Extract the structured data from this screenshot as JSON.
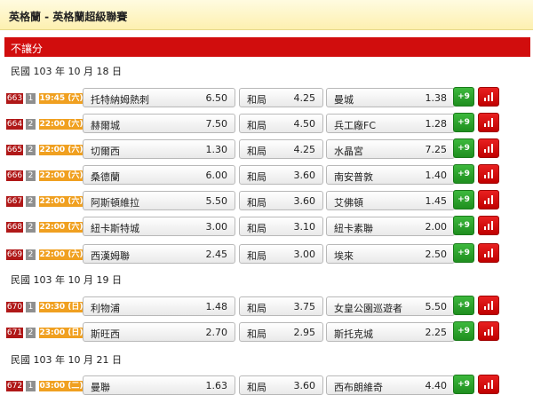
{
  "header": {
    "title": "英格蘭 - 英格蘭超級聯賽"
  },
  "section": {
    "label": "不讓分"
  },
  "colors": {
    "accent": "#d10d0d",
    "plus": "#2aa22a",
    "time": "#f0a020"
  },
  "groups": [
    {
      "date": "民國 103 年 10 月 18 日",
      "matches": [
        {
          "id": "663",
          "num": "1",
          "time": "19:45 (六)",
          "home": "托特納姆熱刺",
          "home_odds": "6.50",
          "draw": "和局",
          "draw_odds": "4.25",
          "away": "曼城",
          "away_odds": "1.38",
          "plus": "+9"
        },
        {
          "id": "664",
          "num": "2",
          "time": "22:00 (六)",
          "home": "赫爾城",
          "home_odds": "7.50",
          "draw": "和局",
          "draw_odds": "4.50",
          "away": "兵工廠FC",
          "away_odds": "1.28",
          "plus": "+9"
        },
        {
          "id": "665",
          "num": "2",
          "time": "22:00 (六)",
          "home": "切爾西",
          "home_odds": "1.30",
          "draw": "和局",
          "draw_odds": "4.25",
          "away": "水晶宮",
          "away_odds": "7.25",
          "plus": "+9"
        },
        {
          "id": "666",
          "num": "2",
          "time": "22:00 (六)",
          "home": "桑德蘭",
          "home_odds": "6.00",
          "draw": "和局",
          "draw_odds": "3.60",
          "away": "南安普敦",
          "away_odds": "1.40",
          "plus": "+9"
        },
        {
          "id": "667",
          "num": "2",
          "time": "22:00 (六)",
          "home": "阿斯頓維拉",
          "home_odds": "5.50",
          "draw": "和局",
          "draw_odds": "3.60",
          "away": "艾佛頓",
          "away_odds": "1.45",
          "plus": "+9"
        },
        {
          "id": "668",
          "num": "2",
          "time": "22:00 (六)",
          "home": "紐卡斯特城",
          "home_odds": "3.00",
          "draw": "和局",
          "draw_odds": "3.10",
          "away": "紐卡素聯",
          "away_odds": "2.00",
          "plus": "+9"
        },
        {
          "id": "669",
          "num": "2",
          "time": "22:00 (六)",
          "home": "西漢姆聯",
          "home_odds": "2.45",
          "draw": "和局",
          "draw_odds": "3.00",
          "away": "埃來",
          "away_odds": "2.50",
          "plus": "+9"
        }
      ]
    },
    {
      "date": "民國 103 年 10 月 19 日",
      "matches": [
        {
          "id": "670",
          "num": "1",
          "time": "20:30 (日)",
          "home": "利物浦",
          "home_odds": "1.48",
          "draw": "和局",
          "draw_odds": "3.75",
          "away": "女皇公園巡遊者",
          "away_odds": "5.50",
          "plus": "+9"
        },
        {
          "id": "671",
          "num": "2",
          "time": "23:00 (日)",
          "home": "斯旺西",
          "home_odds": "2.70",
          "draw": "和局",
          "draw_odds": "2.95",
          "away": "斯托克城",
          "away_odds": "2.25",
          "plus": "+9"
        }
      ]
    },
    {
      "date": "民國 103 年 10 月 21 日",
      "matches": [
        {
          "id": "672",
          "num": "1",
          "time": "03:00 (二)",
          "home": "曼聯",
          "home_odds": "1.63",
          "draw": "和局",
          "draw_odds": "3.60",
          "away": "西布朗維奇",
          "away_odds": "4.40",
          "plus": "+9"
        }
      ]
    }
  ]
}
